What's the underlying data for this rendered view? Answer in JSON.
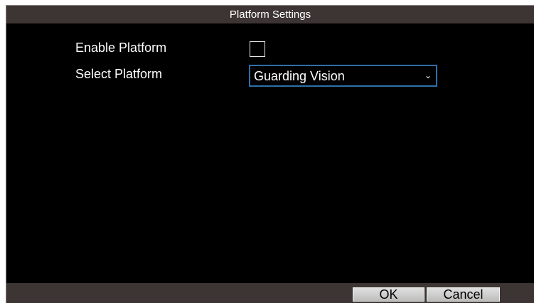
{
  "window": {
    "title": "Platform Settings"
  },
  "form": {
    "enable_label": "Enable Platform",
    "enable_checked": false,
    "select_label": "Select Platform",
    "select_value": "Guarding Vision",
    "select_chevron": "⌄"
  },
  "footer": {
    "ok_label": "OK",
    "cancel_label": "Cancel"
  },
  "colors": {
    "background": "#000000",
    "bar": "#3d3533",
    "focus_border": "#2f6fa8",
    "button": "#d3d3d3"
  }
}
